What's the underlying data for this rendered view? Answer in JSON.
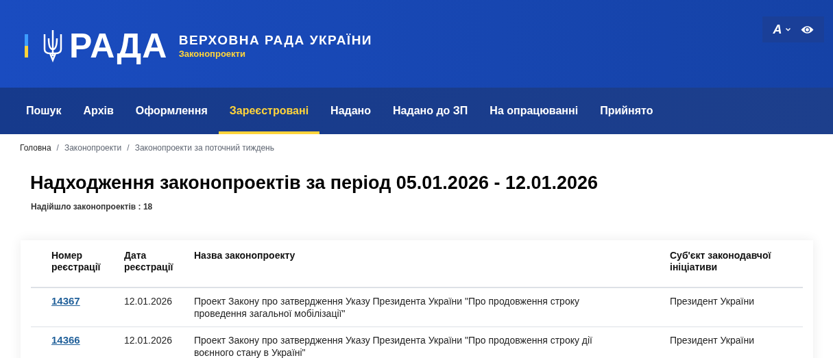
{
  "header": {
    "logo_text": "РАДА",
    "title": "ВЕРХОВНА РАДА УКРАЇНИ",
    "subtitle": "Законопроекти",
    "font_button": "A"
  },
  "nav": [
    {
      "label": "Пошук",
      "selected": false
    },
    {
      "label": "Архів",
      "selected": false
    },
    {
      "label": "Оформлення",
      "selected": false
    },
    {
      "label": "Зареєстровані",
      "selected": true
    },
    {
      "label": "Надано",
      "selected": false
    },
    {
      "label": "Надано до ЗП",
      "selected": false
    },
    {
      "label": "На опрацюванні",
      "selected": false
    },
    {
      "label": "Прийнято",
      "selected": false
    }
  ],
  "breadcrumbs": [
    "Головна",
    "Законопроекти",
    "Законопроекти за поточний тиждень"
  ],
  "breadcrumb_separator": "/",
  "page_title": "Надходження законопроектів за період 05.01.2026 - 12.01.2026",
  "count": "Надійшло законопроектів : 18",
  "table": {
    "columns": [
      "Номер реєстрації",
      "Дата реєстрації",
      "Назва законопроекту",
      "Суб'єкт законодавчої ініціативи"
    ],
    "rows": [
      {
        "number": "14367",
        "date": "12.01.2026",
        "name": "Проект Закону про затвердження Указу Президента України \"Про продовження строку проведення загальної мобілізації\"",
        "subject": "Президент України"
      },
      {
        "number": "14366",
        "date": "12.01.2026",
        "name": "Проект Закону про затвердження Указу Президента України \"Про продовження строку дії воєнного стану в Україні\"",
        "subject": "Президент України"
      }
    ]
  }
}
